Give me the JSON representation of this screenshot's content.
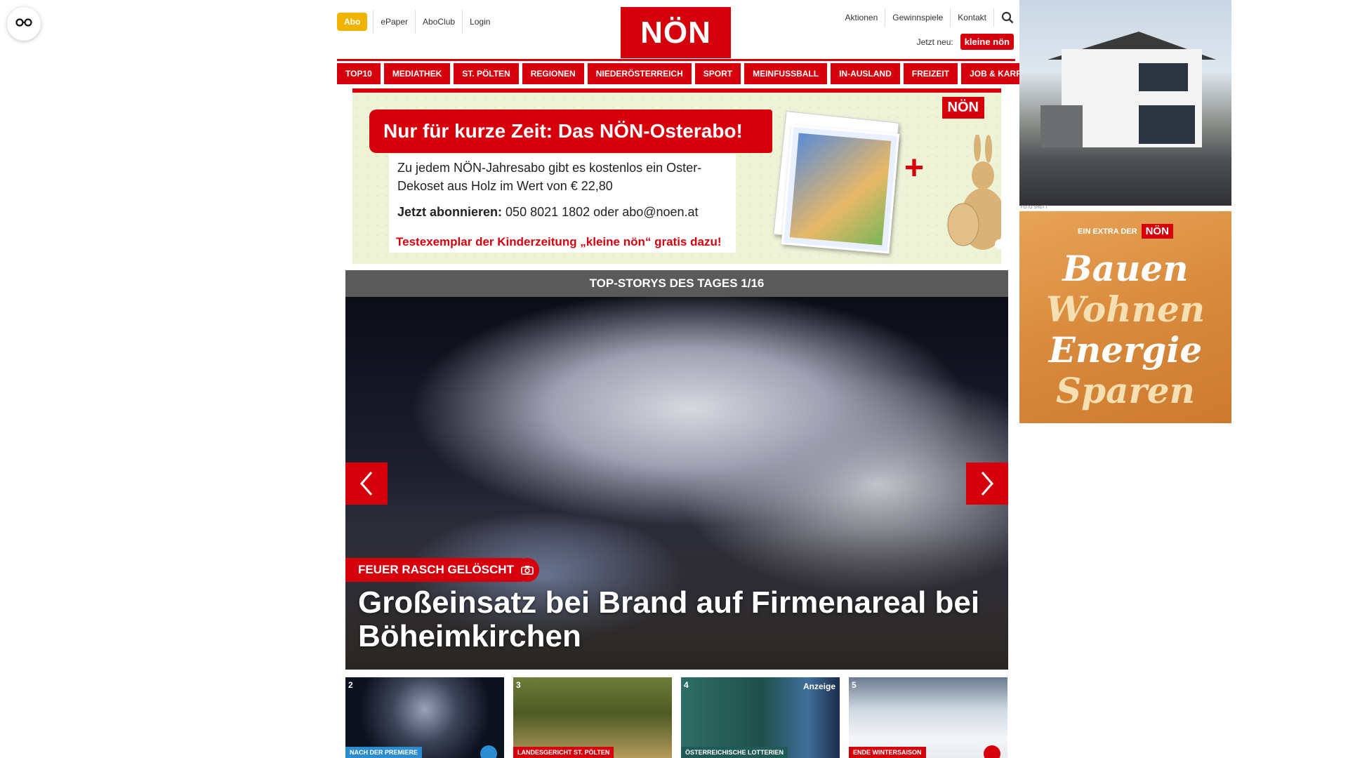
{
  "header": {
    "abo_label": "Abo",
    "left_links": [
      "ePaper",
      "AboClub",
      "Login"
    ],
    "logo_text": "NÖN",
    "right_links": [
      "Aktionen",
      "Gewinnspiele",
      "Kontakt"
    ],
    "jetzt_neu_label": "Jetzt neu:",
    "kleine_non_logo": "kleine nön"
  },
  "nav": [
    "TOP10",
    "MEDIATHEK",
    "ST. PÖLTEN",
    "REGIONEN",
    "NIEDERÖSTERREICH",
    "SPORT",
    "MEINFUSSBALL",
    "IN-AUSLAND",
    "FREIZEIT",
    "JOB & KARRIERE"
  ],
  "promo": {
    "headline": "Nur für kurze Zeit: Das NÖN-Osterabo!",
    "text": "Zu jedem NÖN-Jahresabo gibt es kostenlos ein Oster-Dekoset aus Holz im Wert von € 22,80",
    "contact_label": "Jetzt abonnieren:",
    "contact_value": "050 8021 1802 oder abo@noen.at",
    "note": "Testexemplar der Kinderzeitung „kleine nön“ gratis dazu!",
    "logo": "NÖN"
  },
  "stories": {
    "header": "TOP-STORYS DES TAGES 1/16",
    "hero_kicker": "FEUER RASCH GELÖSCHT",
    "hero_title": "Großeinsatz bei Brand auf Firmenareal bei Böheimkirchen",
    "thumbs": [
      {
        "num": "2",
        "caption": "NACH DER PREMIERE",
        "tag": ""
      },
      {
        "num": "3",
        "caption": "LANDESGERICHT ST. PÖLTEN",
        "tag": ""
      },
      {
        "num": "4",
        "caption": "ÖSTERREICHISCHE LOTTERIEN",
        "tag": "Anzeige"
      },
      {
        "num": "5",
        "caption": "ENDE WINTERSAISON",
        "tag": ""
      }
    ]
  },
  "ads": {
    "house_credit": "FOTO SHUTT",
    "bauen_extra": "EIN EXTRA DER",
    "bauen_logo": "NÖN",
    "bauen_words": [
      "Bauen",
      "Wohnen",
      "Energie",
      "Sparen"
    ]
  },
  "colors": {
    "brand_red": "#d6000d",
    "abo_yellow": "#f0b400",
    "bar_gray": "#5a5a5a",
    "ad_orange": "#d98a3c"
  }
}
